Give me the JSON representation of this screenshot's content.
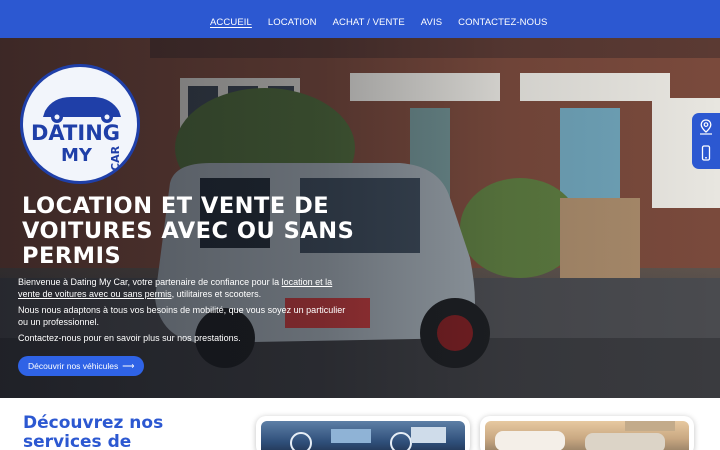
{
  "nav": {
    "items": [
      {
        "label": "ACCUEIL",
        "active": true
      },
      {
        "label": "LOCATION",
        "active": false
      },
      {
        "label": "ACHAT / VENTE",
        "active": false
      },
      {
        "label": "AVIS",
        "active": false
      },
      {
        "label": "CONTACTEZ-NOUS",
        "active": false
      }
    ]
  },
  "logo": {
    "line1": "DATING",
    "line2": "MY",
    "line3": "CAR"
  },
  "hero": {
    "title": "LOCATION ET VENTE DE VOITURES AVEC OU SANS PERMIS",
    "p1_before": "Bienvenue à Dating My Car, votre partenaire de confiance pour la ",
    "p1_link": "location et la vente de voitures avec ou sans permis",
    "p1_after": ", utilitaires et scooters.",
    "p2": "Nous nous adaptons à tous vos besoins de mobilité, que vous soyez un particulier ou un professionnel.",
    "p3": "Contactez-nous pour en savoir plus sur nos prestations.",
    "cta": "Découvrir nos véhicules",
    "cta_arrow": "⟶"
  },
  "side_widget": {
    "icons": [
      "location-pin-icon",
      "phone-icon"
    ]
  },
  "services": {
    "title": "Découvrez nos services de"
  },
  "colors": {
    "brand": "#2c58d1",
    "cta": "#2f63e6",
    "white": "#ffffff"
  }
}
